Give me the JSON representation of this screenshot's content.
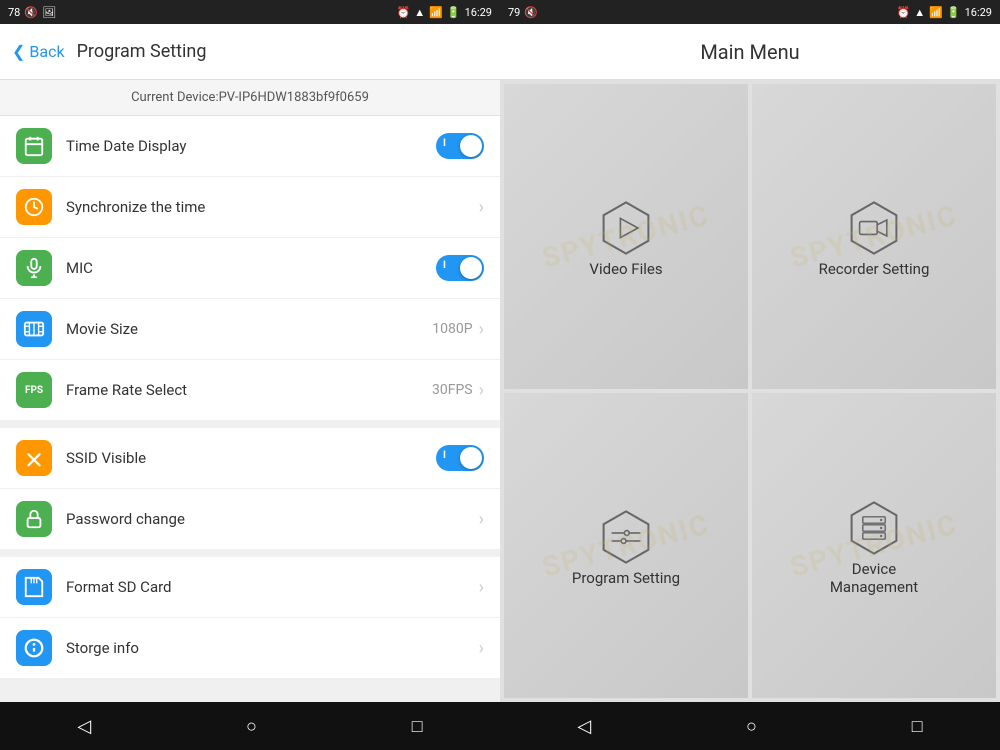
{
  "left": {
    "statusBar": {
      "left": "78  🔇  🖼",
      "time": "16:29",
      "icons": "⏰ 📶 🔋"
    },
    "header": {
      "backLabel": "Back",
      "title": "Program Setting"
    },
    "deviceInfo": "Current Device:PV-IP6HDW1883bf9f0659",
    "settings": [
      {
        "id": "time-date-display",
        "label": "Time Date Display",
        "iconColor": "icon-green",
        "iconSymbol": "📅",
        "type": "toggle",
        "value": "on"
      },
      {
        "id": "synchronize-time",
        "label": "Synchronize the time",
        "iconColor": "icon-orange",
        "iconSymbol": "🕐",
        "type": "chevron"
      },
      {
        "id": "mic",
        "label": "MIC",
        "iconColor": "icon-green",
        "iconSymbol": "🎤",
        "type": "toggle",
        "value": "on"
      },
      {
        "id": "movie-size",
        "label": "Movie Size",
        "iconColor": "icon-blue",
        "iconSymbol": "🎬",
        "type": "value-chevron",
        "value": "1080P"
      },
      {
        "id": "frame-rate",
        "label": "Frame Rate Select",
        "iconColor": "icon-green-fps",
        "iconSymbol": "FPS",
        "type": "value-chevron",
        "value": "30FPS"
      }
    ],
    "settings2": [
      {
        "id": "ssid-visible",
        "label": "SSID Visible",
        "iconColor": "icon-orange-wifi",
        "iconSymbol": "📡",
        "type": "toggle",
        "value": "on"
      },
      {
        "id": "password-change",
        "label": "Password change",
        "iconColor": "icon-green-lock",
        "iconSymbol": "🔒",
        "type": "chevron"
      }
    ],
    "settings3": [
      {
        "id": "format-sd",
        "label": "Format SD Card",
        "iconColor": "icon-blue-sd",
        "iconSymbol": "💾",
        "type": "chevron"
      },
      {
        "id": "storage-info",
        "label": "Storge info",
        "iconColor": "icon-blue-info",
        "iconSymbol": "ℹ",
        "type": "chevron"
      }
    ],
    "bottomNav": {
      "back": "◁",
      "home": "○",
      "recent": "□"
    }
  },
  "right": {
    "statusBar": {
      "left": "79  🔇",
      "time": "16:29"
    },
    "header": {
      "title": "Main Menu"
    },
    "menuItems": [
      {
        "id": "video-files",
        "label": "Video Files",
        "iconType": "play"
      },
      {
        "id": "recorder-setting",
        "label": "Recorder Setting",
        "iconType": "recorder"
      },
      {
        "id": "program-setting",
        "label": "Program Setting",
        "iconType": "settings"
      },
      {
        "id": "device-management",
        "label": "Device\nManagement",
        "iconType": "device"
      }
    ],
    "watermark": "SPYTRONIC",
    "bottomNav": {
      "back": "◁",
      "home": "○",
      "recent": "□"
    }
  }
}
